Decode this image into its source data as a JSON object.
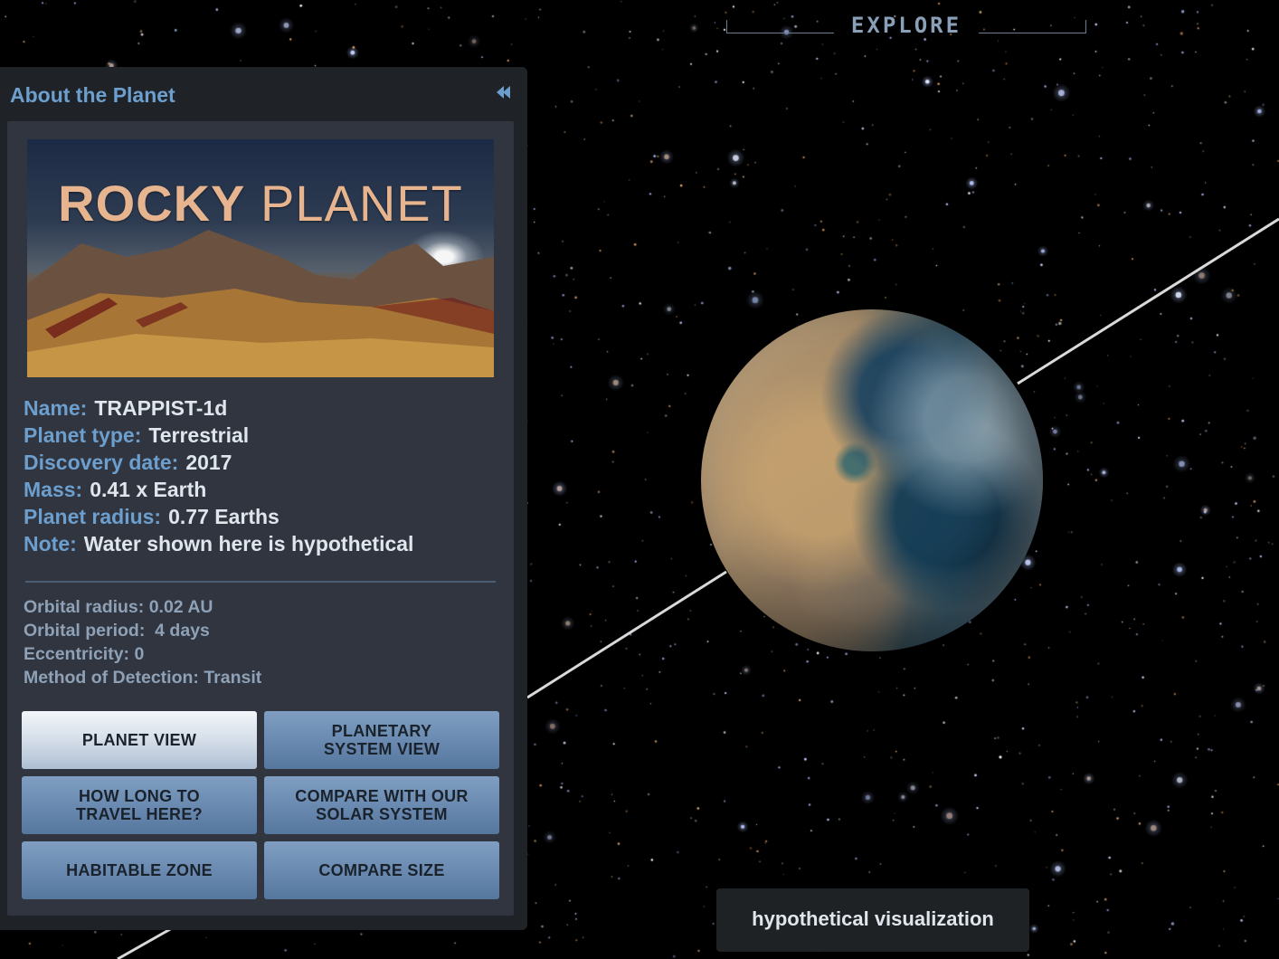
{
  "header": {
    "title": "EXPLORE"
  },
  "panel": {
    "title": "About the Planet",
    "collapse_icon": "double-chevron-left-icon",
    "banner": {
      "word1": "ROCKY",
      "word2": "PLANET"
    },
    "facts": [
      {
        "key": "Name:",
        "value": "TRAPPIST-1d"
      },
      {
        "key": "Planet type:",
        "value": "Terrestrial"
      },
      {
        "key": "Discovery date:",
        "value": "2017"
      },
      {
        "key": "Mass:",
        "value": "0.41 x Earth"
      },
      {
        "key": "Planet radius:",
        "value": "0.77 Earths"
      },
      {
        "key": "Note:",
        "value": "Water shown here is hypothetical"
      }
    ],
    "orbit_facts": [
      "Orbital radius: 0.02 AU",
      "Orbital period:  4 days",
      "Eccentricity: 0",
      "Method of Detection: Transit"
    ],
    "buttons": [
      {
        "label": "PLANET VIEW",
        "active": true
      },
      {
        "label": "PLANETARY\nSYSTEM VIEW",
        "active": false
      },
      {
        "label": "HOW LONG TO\nTRAVEL HERE?",
        "active": false
      },
      {
        "label": "COMPARE WITH OUR\nSOLAR SYSTEM",
        "active": false
      },
      {
        "label": "HABITABLE ZONE",
        "active": false
      },
      {
        "label": "COMPARE SIZE",
        "active": false
      }
    ]
  },
  "caption": "hypothetical visualization",
  "colors": {
    "accent": "#6d9fce",
    "panel_bg": "#1f2328",
    "panel_inner_bg": "#30353f",
    "button_bg": "#6a8ab1",
    "button_active_bg": "#dfe6ee",
    "orbit_line": "#d9d9d9"
  }
}
